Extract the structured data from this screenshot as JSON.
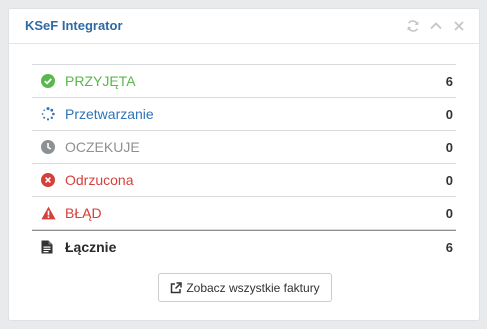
{
  "widget": {
    "title": "KSeF Integrator",
    "tools": [
      "refresh-icon",
      "chevron-up-icon",
      "close-icon"
    ]
  },
  "statuses": [
    {
      "label": "PRZYJĘTA",
      "count": "6",
      "icon": "check-circle-icon",
      "color": "#58b84c"
    },
    {
      "label": "Przetwarzanie",
      "count": "0",
      "icon": "spinner-icon",
      "color": "#2f74b8"
    },
    {
      "label": "OCZEKUJE",
      "count": "0",
      "icon": "clock-icon",
      "color": "#8e9194"
    },
    {
      "label": "Odrzucona",
      "count": "0",
      "icon": "x-circle-icon",
      "color": "#d6403b"
    },
    {
      "label": "BŁĄD",
      "count": "0",
      "icon": "warning-icon",
      "color": "#d6403b"
    }
  ],
  "total": {
    "label": "Łącznie",
    "count": "6",
    "icon": "document-icon"
  },
  "footer": {
    "button_label": "Zobacz wszystkie faktury",
    "button_icon": "external-link-icon"
  }
}
